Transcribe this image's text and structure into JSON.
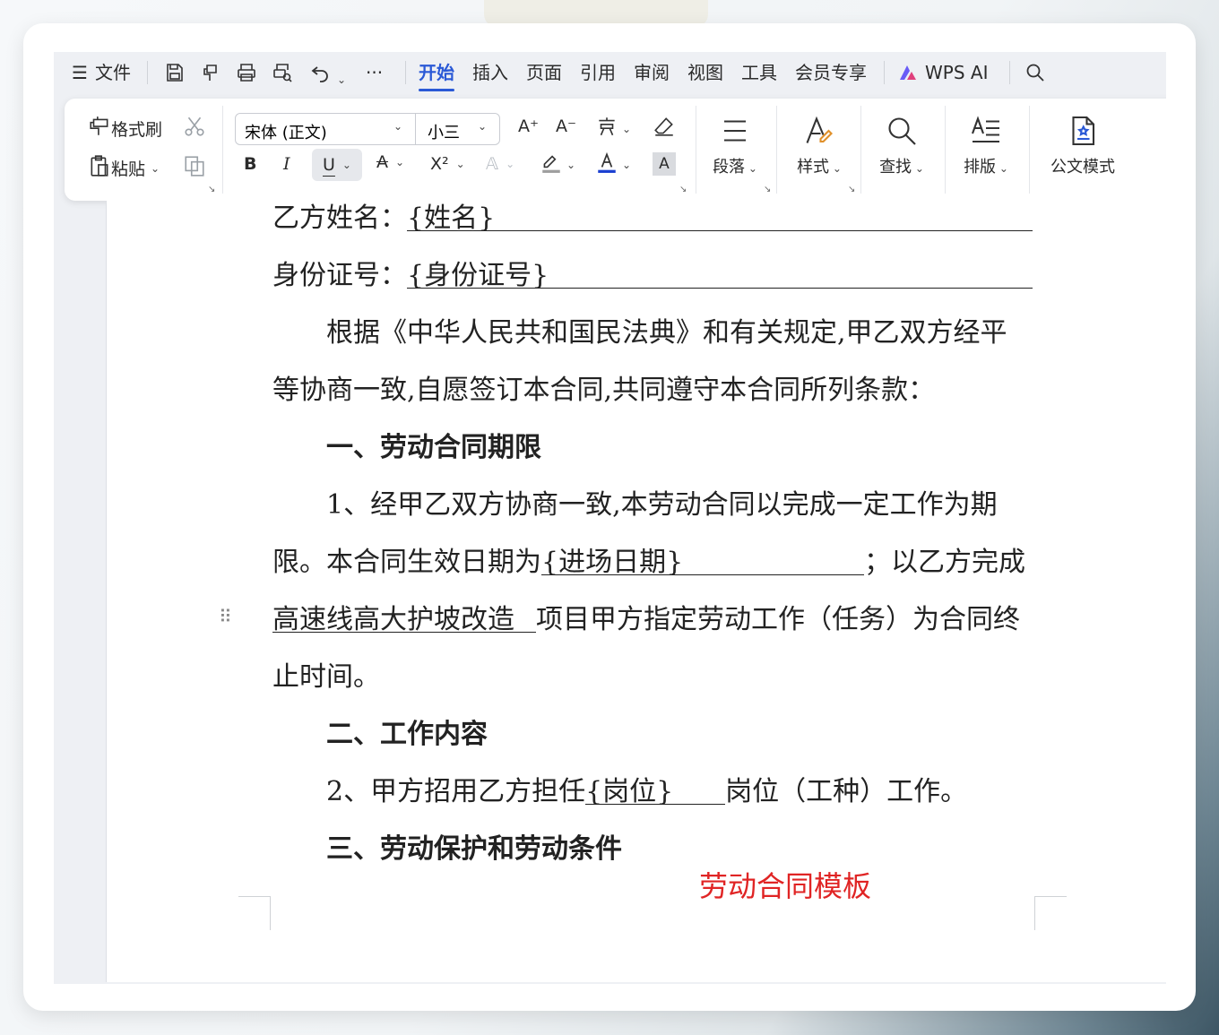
{
  "menu": {
    "file": "文件",
    "tabs": [
      "开始",
      "插入",
      "页面",
      "引用",
      "审阅",
      "视图",
      "工具",
      "会员专享"
    ],
    "active_tab": "开始",
    "ai": "WPS AI",
    "more": "···"
  },
  "ribbon": {
    "format_painter": "格式刷",
    "paste": "粘贴",
    "font_name": "宋体 (正文)",
    "font_size": "小三",
    "bold": "B",
    "italic": "I",
    "underline": "U",
    "superscript": "X²",
    "font_grow": "A⁺",
    "font_shrink": "A⁻",
    "highlight_box": "A",
    "paragraph": "段落",
    "style": "样式",
    "find": "查找",
    "layout": "排版",
    "official_mode": "公文模式",
    "accent_color": "#2a59d6",
    "font_color": "#1a3fd1"
  },
  "document": {
    "name_label": "乙方姓名：",
    "name_value": "{姓名}",
    "id_label": "身份证号：",
    "id_value": "{身份证号}",
    "p1a": "根据《中华人民共和国民法典》和有关规定,甲乙双方经平",
    "p1b": "等协商一致,自愿签订本合同,共同遵守本合同所列条款：",
    "h1": "一、劳动合同期限",
    "p2a": "1、经甲乙双方协商一致,本劳动合同以完成一定工作为期",
    "p2b_pre": "限。本合同生效日期为",
    "p2b_field": "{进场日期}",
    "p2b_post": "；以乙方完成",
    "p2c_field": "高速线高大护坡改造",
    "p2c_post": "项目甲方指定劳动工作（任务）为合同终",
    "p2d": "止时间。",
    "h2": "二、工作内容",
    "p3_pre": "2、甲方招用乙方担任",
    "p3_field": "{岗位}",
    "p3_post": "岗位（工种）工作。",
    "h3": "三、劳动保护和劳动条件",
    "watermark": "劳动合同模板"
  }
}
